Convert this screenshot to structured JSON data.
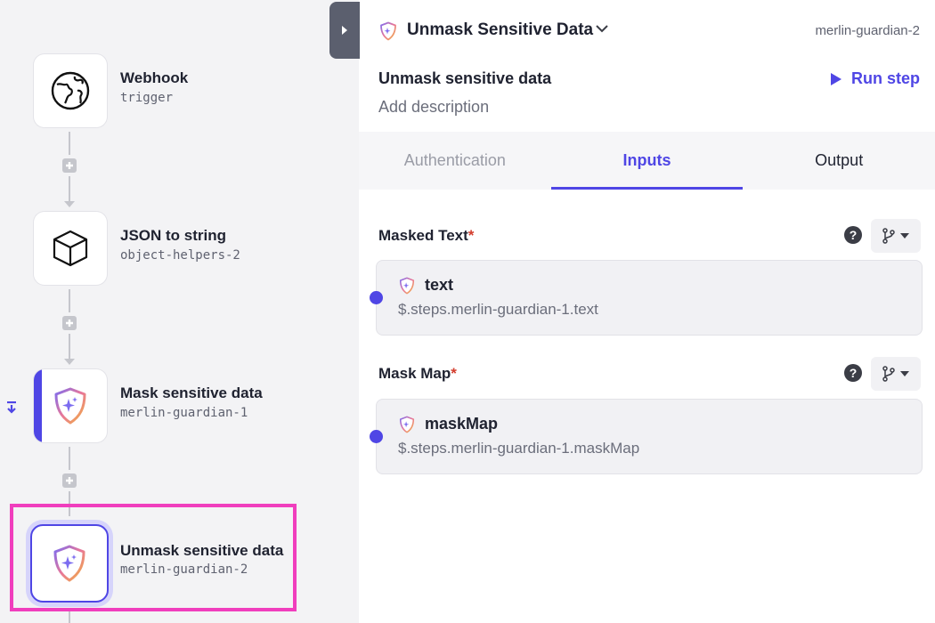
{
  "flow": {
    "nodes": [
      {
        "title": "Webhook",
        "subtitle": "trigger",
        "icon": "globe-icon"
      },
      {
        "title": "JSON to string",
        "subtitle": "object-helpers-2",
        "icon": "cube-icon"
      },
      {
        "title": "Mask sensitive data",
        "subtitle": "merlin-guardian-1",
        "icon": "shield-sparkle-icon"
      },
      {
        "title": "Unmask sensitive data",
        "subtitle": "merlin-guardian-2",
        "icon": "shield-sparkle-icon"
      }
    ],
    "plus_icon": "plus-icon",
    "break_icon": "breakpoint-icon",
    "selected_node": "Unmask sensitive data"
  },
  "panel": {
    "header": {
      "title": "Unmask Sensitive Data",
      "slug": "merlin-guardian-2"
    },
    "step_name": "Unmask sensitive data",
    "description_placeholder": "Add description",
    "run_step_label": "Run step",
    "tabs": [
      {
        "label": "Authentication",
        "active": false
      },
      {
        "label": "Inputs",
        "active": true
      },
      {
        "label": "Output",
        "active": false
      }
    ],
    "inputs": [
      {
        "label": "Masked Text",
        "required_mark": "*",
        "pill_label": "text",
        "path": "$.steps.merlin-guardian-1.text"
      },
      {
        "label": "Mask Map",
        "required_mark": "*",
        "pill_label": "maskMap",
        "path": "$.steps.merlin-guardian-1.maskMap"
      }
    ],
    "help_symbol": "?"
  },
  "colors": {
    "accent": "#4f46e5",
    "highlight": "#f03ebd",
    "required": "#d33c2c"
  }
}
